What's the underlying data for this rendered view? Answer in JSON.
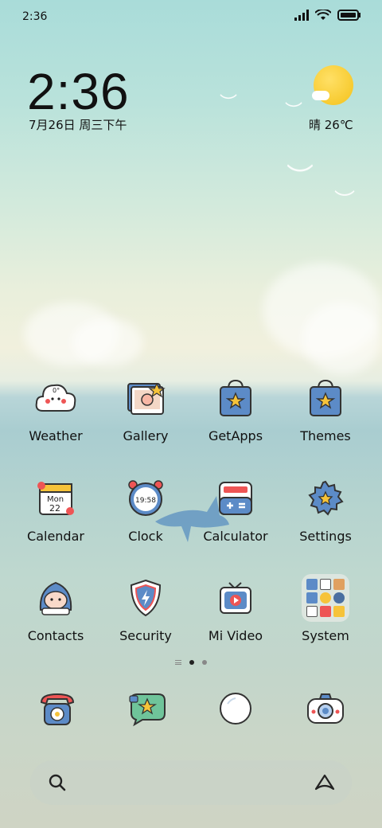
{
  "status_bar": {
    "time": "2:36"
  },
  "widget": {
    "clock": "2:36",
    "date": "7月26日 周三下午",
    "weather": "晴 26℃"
  },
  "apps": [
    {
      "label": "Weather",
      "icon": "weather-cloud-icon"
    },
    {
      "label": "Gallery",
      "icon": "gallery-icon"
    },
    {
      "label": "GetApps",
      "icon": "getapps-bag-icon"
    },
    {
      "label": "Themes",
      "icon": "themes-bag-icon"
    },
    {
      "label": "Calendar",
      "icon": "calendar-icon",
      "icon_text_1": "Mon",
      "icon_text_2": "22"
    },
    {
      "label": "Clock",
      "icon": "alarm-clock-icon",
      "icon_text": "19:58"
    },
    {
      "label": "Calculator",
      "icon": "calculator-icon"
    },
    {
      "label": "Settings",
      "icon": "gear-icon"
    },
    {
      "label": "Contacts",
      "icon": "contacts-icon"
    },
    {
      "label": "Security",
      "icon": "shield-icon"
    },
    {
      "label": "Mi Video",
      "icon": "tv-play-icon"
    },
    {
      "label": "System",
      "icon": "folder-icon"
    }
  ],
  "weather_icon_text": "0°",
  "page_indicator": {
    "pages": 2,
    "active": 1
  },
  "dock": [
    {
      "name": "phone",
      "icon": "phone-icon"
    },
    {
      "name": "messages",
      "icon": "messages-icon"
    },
    {
      "name": "browser",
      "icon": "browser-icon"
    },
    {
      "name": "camera",
      "icon": "camera-icon"
    }
  ],
  "search": {
    "icon": "search-icon",
    "assistant_icon": "assistant-icon"
  },
  "colors": {
    "accent_blue": "#4a7fc1",
    "accent_yellow": "#f6c33a",
    "text": "#111111"
  }
}
